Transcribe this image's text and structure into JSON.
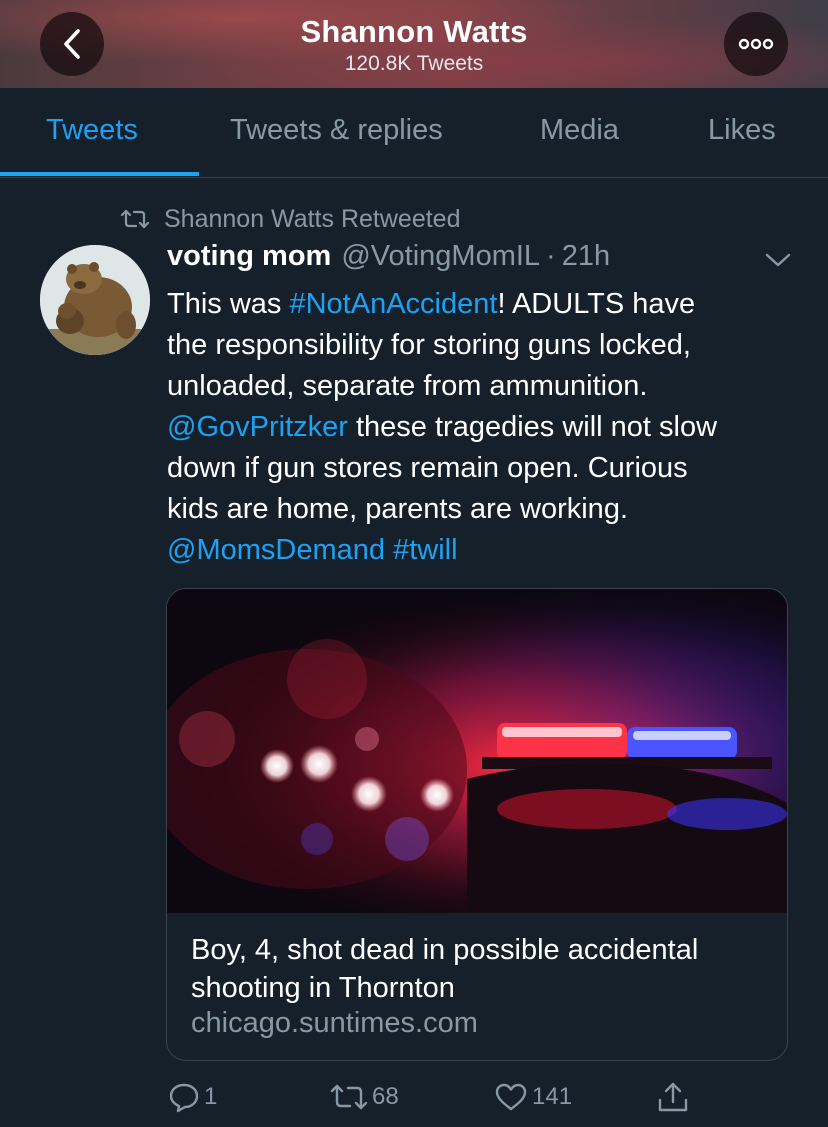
{
  "header": {
    "title": "Shannon Watts",
    "subtitle": "120.8K Tweets",
    "back_icon": "chevron-left-icon",
    "more_icon": "more-dots-icon"
  },
  "tabs": [
    {
      "label": "Tweets",
      "active": true
    },
    {
      "label": "Tweets & replies",
      "active": false
    },
    {
      "label": "Media",
      "active": false
    },
    {
      "label": "Likes",
      "active": false
    }
  ],
  "tweet": {
    "retweeted_by": "Shannon Watts Retweeted",
    "author_name": "voting mom",
    "author_handle": "@VotingMomIL",
    "separator": "·",
    "time": "21h",
    "text_lines": [
      [
        "This was ",
        "#NotAnAccident",
        "! ADULTS have"
      ],
      [
        "the responsibility for storing guns locked,"
      ],
      [
        "unloaded, separate from ammunition."
      ],
      [
        "@GovPritzker",
        " these tragedies will not slow"
      ],
      [
        "down if gun stores remain open. Curious"
      ],
      [
        "kids are home, parents are working."
      ],
      [
        "@MomsDemand",
        " ",
        "#twill"
      ]
    ],
    "text": {
      "line1_a": "This was ",
      "hashtag1": "#NotAnAccident",
      "line1_b": "! ADULTS have",
      "line2": "the responsibility for storing guns locked,",
      "line3": "unloaded, separate from ammunition.",
      "mention1": "@GovPritzker",
      "line4_b": " these tragedies will not slow",
      "line5": "down if gun stores remain open. Curious",
      "line6": "kids are home, parents are working.",
      "mention2": "@MomsDemand",
      "space": " ",
      "hashtag2": "#twill"
    },
    "card": {
      "title": "Boy, 4, shot dead in possible accidental shooting in Thornton",
      "domain": "chicago.suntimes.com"
    },
    "actions": {
      "reply_count": "1",
      "retweet_count": "68",
      "like_count": "141"
    }
  },
  "colors": {
    "background": "#15202b",
    "accent": "#1da1f2",
    "secondary_text": "#8899a6",
    "divider": "#38444d"
  }
}
